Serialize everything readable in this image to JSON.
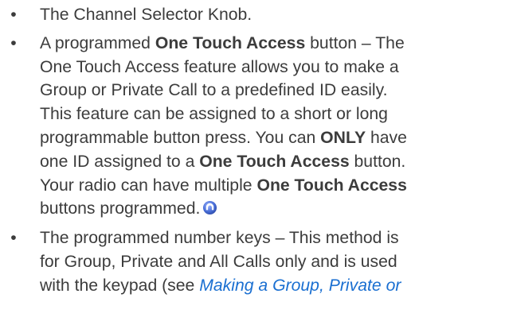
{
  "bullet_char": "•",
  "items": [
    {
      "lines": [
        "The Channel Selector Knob."
      ]
    },
    {
      "line1": {
        "prefix": "A programmed ",
        "bold": "One Touch Access",
        "suffix": " button – The"
      },
      "line2": "One Touch Access feature allows you to make a",
      "line3": "Group or Private Call to a predefined ID easily.",
      "line4": "This feature can be assigned to a short or long",
      "line5": {
        "prefix": "programmable button press. You can ",
        "bold": "ONLY",
        "suffix": " have"
      },
      "line6": {
        "prefix": "one ID assigned to a ",
        "bold": "One Touch Access",
        "suffix": " button."
      },
      "line7": {
        "prefix": "Your radio can have multiple ",
        "bold": "One Touch Access"
      },
      "line8": "buttons programmed.",
      "icon": "feature-indicator-icon"
    },
    {
      "line1": "The programmed number keys – This method is",
      "line2": "for Group, Private and All Calls only and is used",
      "line3": {
        "prefix": "with the keypad (see ",
        "link": "Making a Group, Private or"
      }
    }
  ],
  "colors": {
    "text": "#3c3c3c",
    "link": "#1a6fd1",
    "icon_fill": "#4a6fd8"
  }
}
